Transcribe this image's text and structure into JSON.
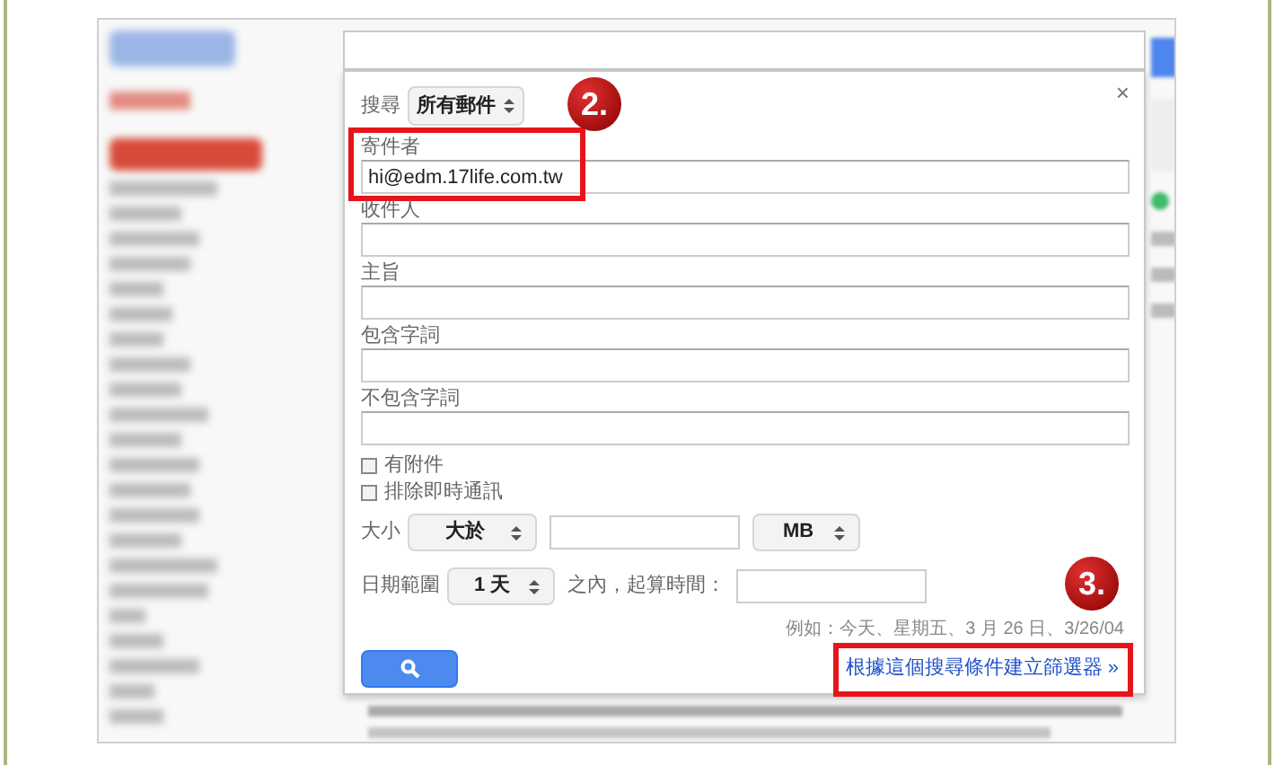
{
  "dialog": {
    "scope_label": "搜尋",
    "scope_select": "所有郵件",
    "close": "×",
    "fields": [
      {
        "label": "寄件者",
        "value": "hi@edm.17life.com.tw",
        "highlighted": true,
        "step": "2."
      },
      {
        "label": "收件人",
        "highlighted": false
      },
      {
        "label": "主旨",
        "highlighted": false
      },
      {
        "label": "包含字詞",
        "highlighted": false
      },
      {
        "label": "不包含字詞",
        "highlighted": false
      }
    ],
    "checkboxes": [
      {
        "label": "有附件",
        "checked": false
      },
      {
        "label": "排除即時通訊",
        "checked": false
      }
    ],
    "size": {
      "label": "大小",
      "operator": "大於",
      "unit": "MB"
    },
    "date": {
      "label": "日期範圍",
      "range": "1 天",
      "within": "之內，起算時間："
    },
    "example": "例如：今天、星期五、3 月 26 日、3/26/04",
    "filter_link": {
      "text": "根據這個搜尋條件建立篩選器 »",
      "highlighted": true,
      "step": "3."
    }
  }
}
